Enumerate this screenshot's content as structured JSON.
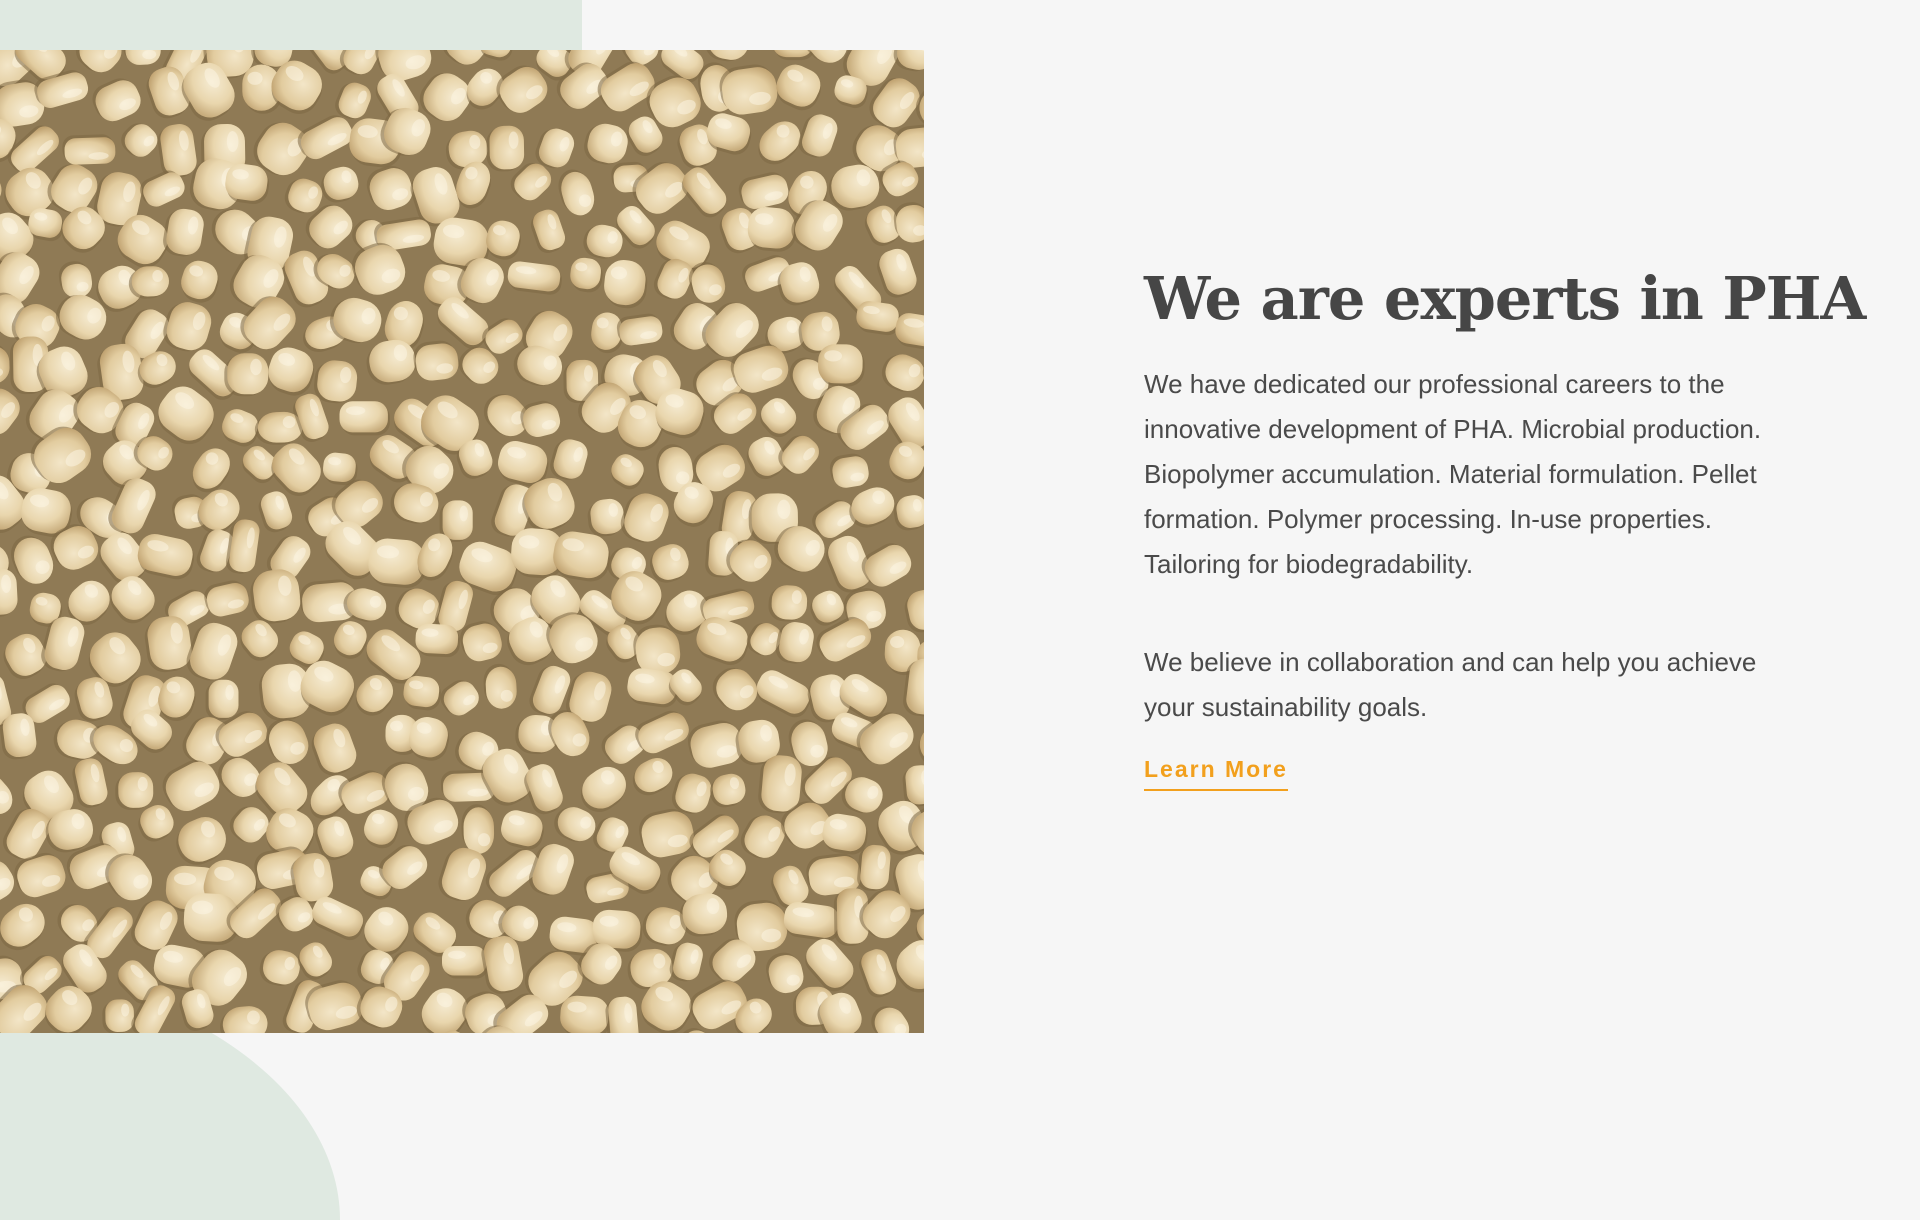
{
  "hero": {
    "image": {
      "subject": "PHA pellets"
    },
    "heading": "We are experts in PHA",
    "paragraphs": [
      "We have dedicated our professional careers to the innovative development of PHA. Microbial production. Biopolymer accumulation. Material formulation. Pellet formation. Polymer processing. In-use properties. Tailoring for biodegradability.",
      "We believe in collaboration and can help you achieve your sustainability goals."
    ],
    "cta_label": "Learn More"
  },
  "colors": {
    "background": "#f6f6f6",
    "accent_shape": "#dfe9e1",
    "heading": "#464646",
    "body_text": "#4a4a4a",
    "link": "#f2a01d",
    "pellet_light": "#f1e3c3",
    "pellet_shadow": "#9c865e"
  }
}
